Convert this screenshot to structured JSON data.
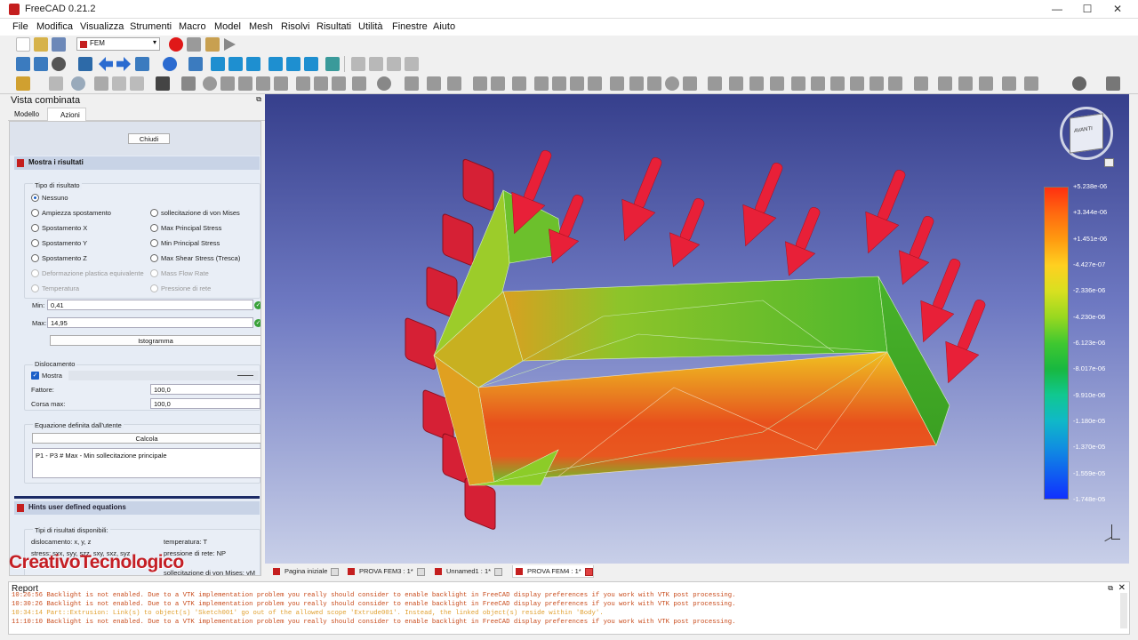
{
  "window": {
    "title": "FreeCAD 0.21.2"
  },
  "menu": [
    "File",
    "Modifica",
    "Visualizza",
    "Strumenti",
    "Macro",
    "Model",
    "Mesh",
    "Risolvi",
    "Risultati",
    "Utilità",
    "Finestre",
    "Aiuto"
  ],
  "toolbar": {
    "workbench": "FEM"
  },
  "combo": {
    "title": "Vista combinata",
    "tabs": [
      "Modello",
      "Azioni"
    ],
    "close_button": "Chiudi",
    "panel_title": "Mostra i risultati",
    "result_type_label": "Tipo di risultato",
    "radios_left": [
      "Nessuno",
      "Ampiezza spostamento",
      "Spostamento X",
      "Spostamento Y",
      "Spostamento Z",
      "Deformazione plastica equivalente",
      "Temperatura"
    ],
    "radios_right": [
      "sollecitazione di von Mises",
      "Max Principal Stress",
      "Min Principal Stress",
      "Max Shear Stress (Tresca)",
      "Mass Flow Rate",
      "Pressione di rete"
    ],
    "min_label": "Min:",
    "min_value": "0,41",
    "max_label": "Max:",
    "max_value": "14,95",
    "histogram_button": "Istogramma",
    "displacement_label": "Dislocamento",
    "show_label": "Mostra",
    "factor_label": "Fattore:",
    "factor_value": "100,0",
    "maxrun_label": "Corsa max:",
    "maxrun_value": "100,0",
    "equation_label": "Equazione definita dall'utente",
    "calc_button": "Calcola",
    "equation_text": "P1 - P3 # Max - Min sollecitazione principale",
    "hints_title": "Hints user defined equations",
    "hints_avail": "Tipi di risultati disponibili:",
    "hints_disp": "dislocamento: x, y, z",
    "hints_temp": "temperatura: T",
    "hints_stress": "stress: sxx, syy, szz, sxy, sxz, syz",
    "hints_press": "pressione di rete: NP",
    "hints_vm": "sollecitazione di von Mises: vM"
  },
  "colorbar": {
    "labels": [
      "+5.238e-06",
      "+3.344e-06",
      "+1.451e-06",
      "-4.427e-07",
      "-2.336e-06",
      "-4.230e-06",
      "-6.123e-06",
      "-8.017e-06",
      "-9.910e-06",
      "-1.180e-05",
      "-1.370e-05",
      "-1.559e-05",
      "-1.748e-05"
    ],
    "colors": [
      "#ff3010",
      "#ff6a10",
      "#ff9a10",
      "#ffd020",
      "#d8e020",
      "#98d820",
      "#40c830",
      "#18b840",
      "#10c890",
      "#10b8c8",
      "#1090e0",
      "#1060f0",
      "#1030ff"
    ]
  },
  "navcube": {
    "front": "AVANTI"
  },
  "doc_tabs": [
    "Pagina iniziale",
    "PROVA FEM3 : 1*",
    "Unnamed1 : 1*",
    "PROVA FEM4 : 1*"
  ],
  "report": {
    "title": "Report",
    "lines": [
      {
        "text": "10:26:56  Backlight is not enabled. Due to a VTK implementation problem you really should consider to enable backlight in FreeCAD display preferences if you work with VTK post processing.",
        "color": "#c84a1a"
      },
      {
        "text": "10:30:26  Backlight is not enabled. Due to a VTK implementation problem you really should consider to enable backlight in FreeCAD display preferences if you work with VTK post processing.",
        "color": "#c84a1a"
      },
      {
        "text": "10:34:14  Part::Extrusion: Link(s) to object(s) 'Sketch001' go out of the allowed scope 'Extrude001'. Instead, the linked object(s) reside within 'Body'.",
        "color": "#e0a030"
      },
      {
        "text": "11:10:10  Backlight is not enabled. Due to a VTK implementation problem you really should consider to enable backlight in FreeCAD display preferences if you work with VTK post processing.",
        "color": "#c84a1a"
      }
    ]
  },
  "watermark": "CreativoTecnologico"
}
